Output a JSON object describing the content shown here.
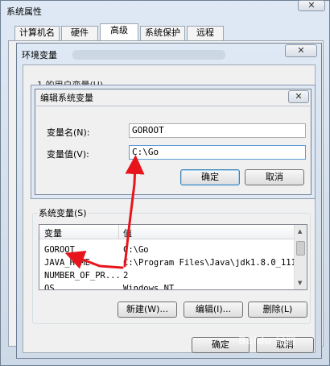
{
  "system_properties": {
    "title": "系统属性",
    "tabs": [
      "计算机名",
      "硬件",
      "高级",
      "系统保护",
      "远程"
    ],
    "active_tab": "高级"
  },
  "env_dialog": {
    "title": "环境变量",
    "user_vars_label": "1    的用户变量(U)",
    "system_vars_label": "系统变量(S)",
    "columns": [
      "变量",
      "值"
    ],
    "system_vars": [
      {
        "name": "GOROOT",
        "value": "C:\\Go"
      },
      {
        "name": "JAVA_HOME",
        "value": "C:\\Program Files\\Java\\jdk1.8.0_111"
      },
      {
        "name": "NUMBER_OF_PR...",
        "value": "2"
      },
      {
        "name": "OS",
        "value": "Windows_NT"
      }
    ],
    "new_button": "新建(W)...",
    "edit_button": "编辑(I)...",
    "delete_button": "删除(L)",
    "ok_button": "确定",
    "cancel_button": "取消"
  },
  "edit_dialog": {
    "title": "编辑系统变量",
    "name_label": "变量名(N):",
    "value_label": "变量值(V):",
    "name_value": "GOROOT",
    "value_value": "C:\\Go",
    "ok_button": "确定",
    "cancel_button": "取消"
  },
  "watermark": "Baidu 经验",
  "colors": {
    "annotation_arrow": "#e8141c",
    "title_bar": "#dfe9f5",
    "default_button_border": "#3c7fb1"
  }
}
